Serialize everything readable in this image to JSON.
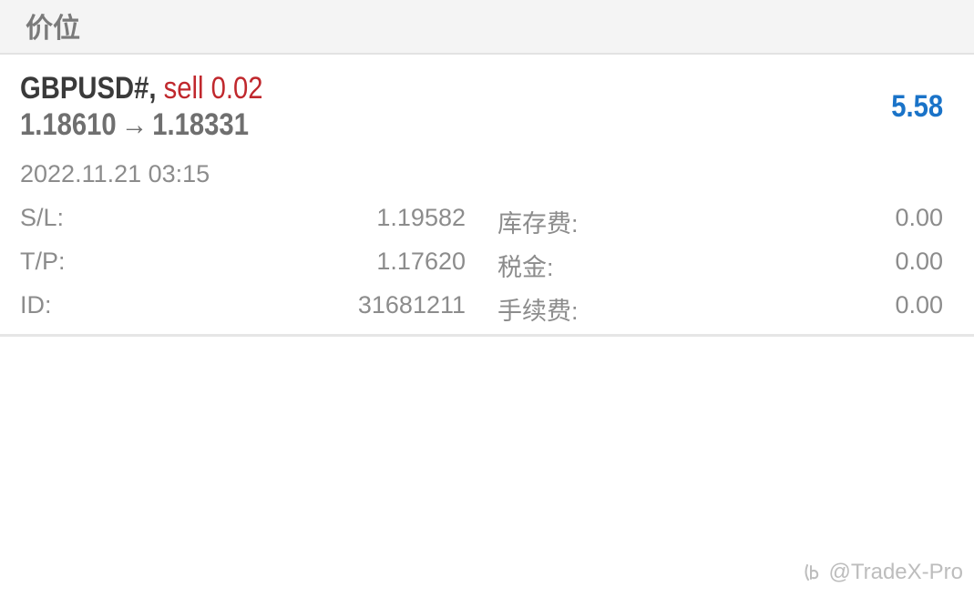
{
  "header": {
    "title": "价位"
  },
  "position": {
    "symbol": "GBPUSD#,",
    "side_volume": "sell 0.02",
    "open_price": "1.18610",
    "arrow": "→",
    "current_price": "1.18331",
    "profit": "5.58",
    "open_time": "2022.11.21 03:15",
    "details": [
      {
        "left_label": "S/L:",
        "left_value": "1.19582",
        "right_label": "库存费:",
        "right_value": "0.00"
      },
      {
        "left_label": "T/P:",
        "left_value": "1.17620",
        "right_label": "税金:",
        "right_value": "0.00"
      },
      {
        "left_label": "ID:",
        "left_value": "31681211",
        "right_label": "手续费:",
        "right_value": "0.00"
      }
    ]
  },
  "watermark": {
    "text": "@TradeX-Pro",
    "icon": "zhihu-logo-icon"
  },
  "colors": {
    "sell": "#c0282d",
    "profit": "#1a73c8",
    "header_bg": "#f4f4f4"
  }
}
